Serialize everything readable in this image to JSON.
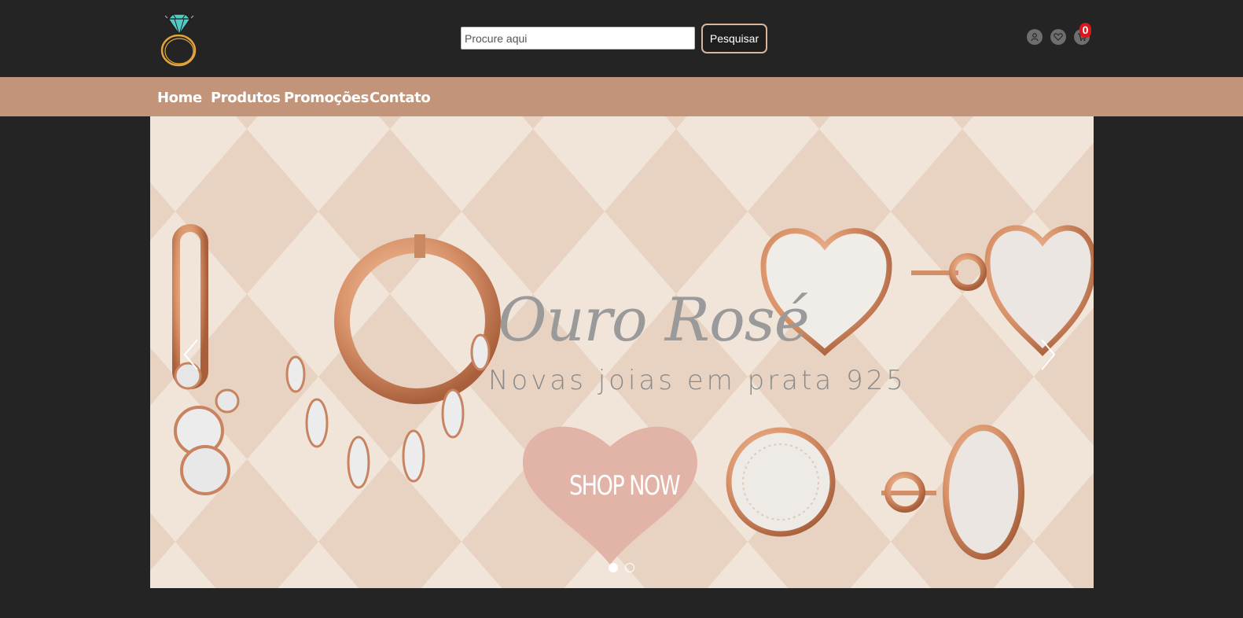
{
  "header": {
    "search": {
      "placeholder": "Procure aqui",
      "value": ""
    },
    "search_button_label": "Pesquisar",
    "cart_count": "0",
    "icons": [
      "diamond-ring-logo",
      "user-icon",
      "heart-icon",
      "cart-icon"
    ]
  },
  "nav": {
    "items": [
      {
        "label": "Home"
      },
      {
        "label": "Produtos"
      },
      {
        "label": "Promoções"
      },
      {
        "label": "Contato"
      }
    ]
  },
  "banner": {
    "title": "Ouro Rosé",
    "subtitle": "Novas joias em prata 925",
    "cta": "SHOP NOW",
    "slides_count": 2,
    "active_slide": 1
  },
  "colors": {
    "page_bg": "#242424",
    "nav_bg": "#c2957a",
    "banner_bg": "#f1e5da",
    "diamond_pattern": "#e8d3c2",
    "heart": "#e2b3a7",
    "rose_gold": "#d9936a",
    "badge": "#e0141b",
    "button_border": "#d9b59c"
  }
}
